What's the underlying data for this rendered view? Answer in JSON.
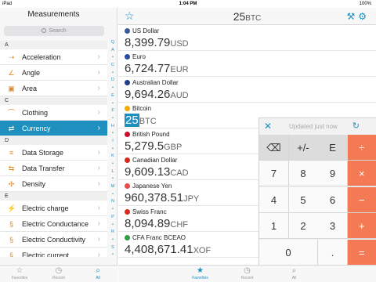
{
  "status": {
    "carrier": "iPad",
    "time": "1:04 PM",
    "battery": "100%"
  },
  "sidebar": {
    "title": "Measurements",
    "search_placeholder": "Search",
    "rows": [
      {
        "type": "header",
        "label": "A"
      },
      {
        "type": "item",
        "label": "Acceleration",
        "icon": "acceleration-icon",
        "glyph": "⇢"
      },
      {
        "type": "item",
        "label": "Angle",
        "icon": "angle-icon",
        "glyph": "∠"
      },
      {
        "type": "item",
        "label": "Area",
        "icon": "area-icon",
        "glyph": "▣"
      },
      {
        "type": "header",
        "label": "C"
      },
      {
        "type": "item",
        "label": "Clothing",
        "icon": "hanger-icon",
        "glyph": "⌒"
      },
      {
        "type": "item",
        "label": "Currency",
        "icon": "currency-icon",
        "glyph": "⇄",
        "selected": true
      },
      {
        "type": "header",
        "label": "D"
      },
      {
        "type": "item",
        "label": "Data Storage",
        "icon": "data-storage-icon",
        "glyph": "≡"
      },
      {
        "type": "item",
        "label": "Data Transfer",
        "icon": "data-transfer-icon",
        "glyph": "⇆"
      },
      {
        "type": "item",
        "label": "Density",
        "icon": "density-icon",
        "glyph": "✣"
      },
      {
        "type": "header",
        "label": "E"
      },
      {
        "type": "item",
        "label": "Electric charge",
        "icon": "electric-charge-icon",
        "glyph": "⚡"
      },
      {
        "type": "item",
        "label": "Electric Conductance",
        "icon": "electric-conductance-icon",
        "glyph": "§"
      },
      {
        "type": "item",
        "label": "Electric Conductivity",
        "icon": "electric-conductivity-icon",
        "glyph": "§"
      },
      {
        "type": "item",
        "label": "Electric current",
        "icon": "electric-current-icon",
        "glyph": "§"
      }
    ],
    "index_letters": [
      "Q",
      "A",
      "•",
      "C",
      "•",
      "D",
      "•",
      "E",
      "•",
      "F",
      "•",
      "H",
      "•",
      "I",
      "•",
      "K",
      "•",
      "L",
      "•",
      "M",
      "•",
      "N",
      "•",
      "P",
      "•",
      "R",
      "•",
      "S",
      "•"
    ],
    "tabs": [
      {
        "label": "Favorites",
        "icon": "star-icon",
        "glyph": "☆",
        "active": false
      },
      {
        "label": "Recent",
        "icon": "clock-icon",
        "glyph": "◷",
        "active": false
      },
      {
        "label": "All",
        "icon": "search-icon",
        "glyph": "⌕",
        "active": true
      }
    ]
  },
  "main": {
    "amount": "25",
    "amount_unit": "BTC",
    "currencies": [
      {
        "name": "US Dollar",
        "value": "8,399.79",
        "unit": "USD",
        "flag": "#3c5a9a",
        "active": false
      },
      {
        "name": "Euro",
        "value": "6,724.77",
        "unit": "EUR",
        "flag": "#2a4aa0",
        "active": false
      },
      {
        "name": "Australian Dollar",
        "value": "9,694.26",
        "unit": "AUD",
        "flag": "#1f3c88",
        "active": false
      },
      {
        "name": "Bitcoin",
        "value": "25",
        "unit": "BTC",
        "flag": "#f2a900",
        "active": true
      },
      {
        "name": "British Pound",
        "value": "5,279.5",
        "unit": "GBP",
        "flag": "#c8102e",
        "active": false
      },
      {
        "name": "Canadian Dollar",
        "value": "9,609.13",
        "unit": "CAD",
        "flag": "#d52b1e",
        "active": false
      },
      {
        "name": "Japanese Yen",
        "value": "960,378.51",
        "unit": "JPY",
        "flag": "#e94b4b",
        "active": false
      },
      {
        "name": "Swiss Franc",
        "value": "8,094.89",
        "unit": "CHF",
        "flag": "#d52b1e",
        "active": false
      },
      {
        "name": "CFA Franc BCEAO",
        "value": "4,408,671.41",
        "unit": "XOF",
        "flag": "#2f9e44",
        "active": false
      }
    ],
    "tabs": [
      {
        "label": "Favorites",
        "icon": "star-icon",
        "glyph": "★",
        "active": true
      },
      {
        "label": "Recent",
        "icon": "clock-icon",
        "glyph": "◷",
        "active": false
      },
      {
        "label": "All",
        "icon": "search-icon",
        "glyph": "⌕",
        "active": false
      }
    ]
  },
  "keypad": {
    "status": "Updated just now",
    "keys": [
      [
        "⌫",
        "+/-",
        "E",
        "÷"
      ],
      [
        "7",
        "8",
        "9",
        "×"
      ],
      [
        "4",
        "5",
        "6",
        "−"
      ],
      [
        "1",
        "2",
        "3",
        "+"
      ],
      [
        "0",
        "",
        ".",
        "="
      ]
    ]
  }
}
